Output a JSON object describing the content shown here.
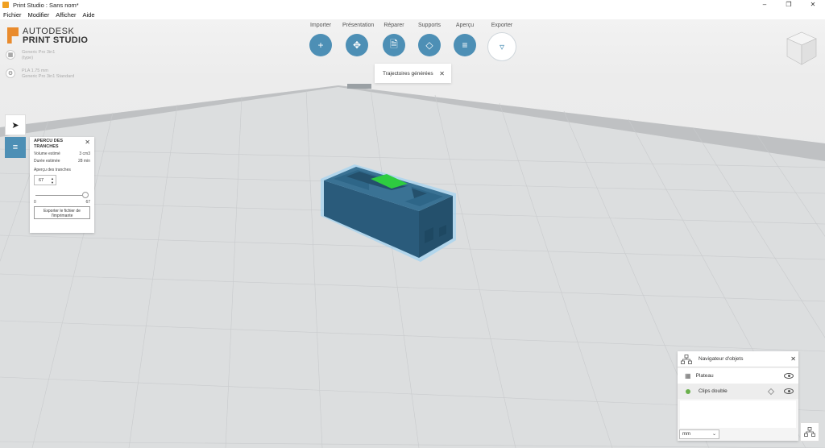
{
  "window": {
    "title": "Print Studio : Sans nom*"
  },
  "menu": [
    "Fichier",
    "Modifier",
    "Afficher",
    "Aide"
  ],
  "brand": {
    "company": "AUTODESK",
    "product": "PRINT STUDIO"
  },
  "printer": {
    "line1": "Generic Pro 3in1",
    "line2": "(type)"
  },
  "material": {
    "line1": "PLA 1.75 mm",
    "line2": "Generic Pro 3in1 Standard"
  },
  "toolbar": {
    "import": "Importer",
    "presentation": "Présentation",
    "repair": "Réparer",
    "supports": "Supports",
    "preview": "Aperçu",
    "export": "Exporter"
  },
  "toast": {
    "message": "Trajectoires générées"
  },
  "slice_panel": {
    "title": "APERCU DES TRANCHES",
    "volume_label": "Volume estimé",
    "volume_value": "3 cm3",
    "duration_label": "Durée estimée",
    "duration_value": "28 min",
    "slices_label": "Aperçu des tranches",
    "slice_value": "67",
    "slider_min": "0",
    "slider_max": "67",
    "slider_fraction": 1.0,
    "export_button": "Exporter le fichier de l'imprimante"
  },
  "navigator": {
    "title": "Navigateur d'objets",
    "items": [
      {
        "label": "Plateau"
      },
      {
        "label": "Clips double",
        "status_color": "#6ab04c"
      }
    ],
    "units": "mm"
  },
  "colors": {
    "accent": "#4d8fb5",
    "object": "#2c5f7f",
    "highlight": "#7fc4ee",
    "brand": "#e98b2d"
  }
}
